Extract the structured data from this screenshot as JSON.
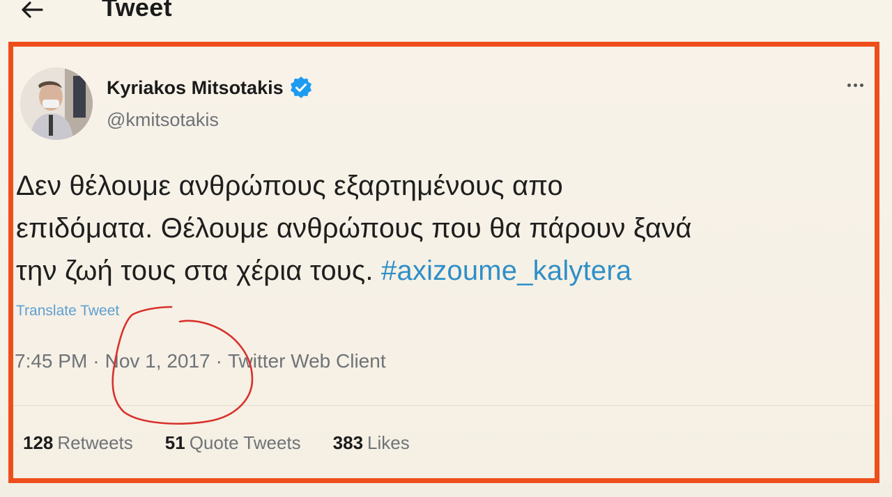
{
  "header": {
    "back_icon": "arrow-left-icon",
    "title": "Tweet"
  },
  "tweet": {
    "author": {
      "name": "Kyriakos Mitsotakis",
      "handle": "@kmitsotakis",
      "verified_icon": "verified-badge-icon"
    },
    "text_lines": [
      "Δεν θέλουμε ανθρώπους εξαρτημένους απο",
      "επιδόματα. Θέλουμε ανθρώπους που θα πάρουν ξανά",
      "την ζωή τους στα χέρια τους."
    ],
    "hashtag": "#axizoume_kalytera",
    "translate_label": "Translate Tweet",
    "time": "7:45 PM",
    "date": "Nov 1, 2017",
    "client": "Twitter Web Client",
    "separator": "·",
    "stats": {
      "retweets_count": "128",
      "retweets_label": "Retweets",
      "quote_count": "51",
      "quote_label": "Quote Tweets",
      "likes_count": "383",
      "likes_label": "Likes"
    }
  },
  "colors": {
    "frame": "#ee4e1c",
    "hashtag": "#2e8fc7",
    "verified": "#1d9bf0",
    "scribble": "#d9302a",
    "background": "#f6f1e7"
  }
}
